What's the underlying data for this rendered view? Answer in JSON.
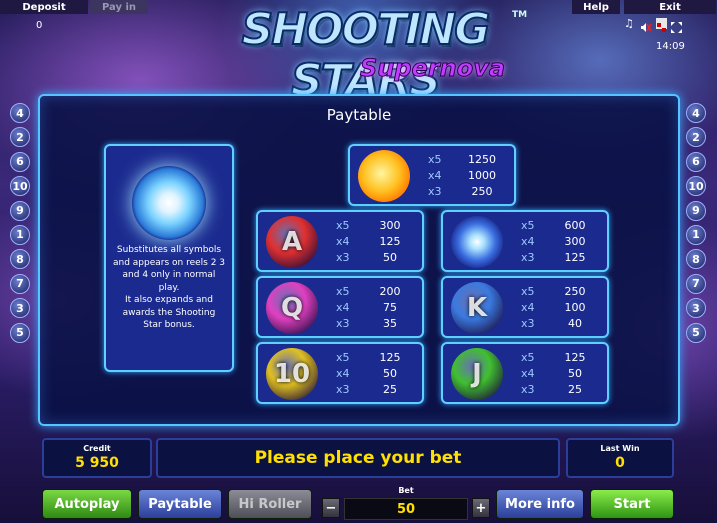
{
  "topbar": {
    "deposit_label": "Deposit",
    "deposit_value": "0",
    "payin_label": "Pay in",
    "help_label": "Help",
    "exit_label": "Exit",
    "clock": "14:09"
  },
  "logo": {
    "title": "SHOOTING STARS",
    "trademark": "TM",
    "subtitle": "Supernova"
  },
  "paylines": {
    "left": [
      "4",
      "2",
      "6",
      "10",
      "9",
      "1",
      "8",
      "7",
      "3",
      "5"
    ],
    "right": [
      "4",
      "2",
      "6",
      "10",
      "9",
      "1",
      "8",
      "7",
      "3",
      "5"
    ]
  },
  "paytable": {
    "title": "Paytable",
    "wild_description": "Substitutes all symbols and appears on reels 2 3 and 4 only in normal play.\nIt also expands and awards the Shooting Star bonus.",
    "symbols": [
      {
        "name": "sun",
        "glyph": "",
        "color": "#ffb020",
        "pays": [
          {
            "mult": "x5",
            "amt": "1250"
          },
          {
            "mult": "x4",
            "amt": "1000"
          },
          {
            "mult": "x3",
            "amt": "250"
          }
        ]
      },
      {
        "name": "a-planet",
        "glyph": "A",
        "color": "#e03030",
        "pays": [
          {
            "mult": "x5",
            "amt": "300"
          },
          {
            "mult": "x4",
            "amt": "125"
          },
          {
            "mult": "x3",
            "amt": "50"
          }
        ]
      },
      {
        "name": "galaxy",
        "glyph": "",
        "color": "#a0d8ff",
        "pays": [
          {
            "mult": "x5",
            "amt": "600"
          },
          {
            "mult": "x4",
            "amt": "300"
          },
          {
            "mult": "x3",
            "amt": "125"
          }
        ]
      },
      {
        "name": "q-planet",
        "glyph": "Q",
        "color": "#e040c0",
        "pays": [
          {
            "mult": "x5",
            "amt": "200"
          },
          {
            "mult": "x4",
            "amt": "75"
          },
          {
            "mult": "x3",
            "amt": "35"
          }
        ]
      },
      {
        "name": "k-planet",
        "glyph": "K",
        "color": "#3a7ae0",
        "pays": [
          {
            "mult": "x5",
            "amt": "250"
          },
          {
            "mult": "x4",
            "amt": "100"
          },
          {
            "mult": "x3",
            "amt": "40"
          }
        ]
      },
      {
        "name": "ten-planet",
        "glyph": "10",
        "color": "#e0c020",
        "pays": [
          {
            "mult": "x5",
            "amt": "125"
          },
          {
            "mult": "x4",
            "amt": "50"
          },
          {
            "mult": "x3",
            "amt": "25"
          }
        ]
      },
      {
        "name": "j-planet",
        "glyph": "J",
        "color": "#40c030",
        "pays": [
          {
            "mult": "x5",
            "amt": "125"
          },
          {
            "mult": "x4",
            "amt": "50"
          },
          {
            "mult": "x3",
            "amt": "25"
          }
        ]
      }
    ]
  },
  "bottom": {
    "credit_label": "Credit",
    "credit_value": "5 950",
    "message": "Please place your bet",
    "last_win_label": "Last Win",
    "last_win_value": "0",
    "bet_label": "Bet",
    "bet_value": "50",
    "bet_minus": "−",
    "bet_plus": "+"
  },
  "buttons": {
    "autoplay": "Autoplay",
    "paytable": "Paytable",
    "hiroller": "Hi Roller",
    "moreinfo": "More info",
    "start": "Start"
  }
}
